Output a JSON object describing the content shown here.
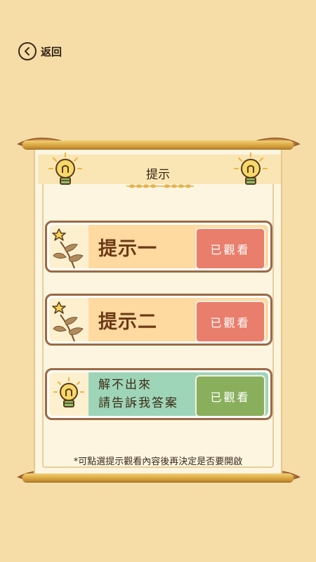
{
  "nav": {
    "back_label": "返回"
  },
  "panel": {
    "title": "提示"
  },
  "hints": [
    {
      "label": "提示一",
      "button": "已觀看"
    },
    {
      "label": "提示二",
      "button": "已觀看"
    },
    {
      "label_line1": "解不出來",
      "label_line2": "請告訴我答案",
      "button": "已觀看"
    }
  ],
  "footer_note": "*可點選提示觀看內容後再決定是否要開啟",
  "colors": {
    "background": "#f6dca6",
    "hint_body": "#fed9a0",
    "answer_body": "#9ed5b9",
    "watched_red": "#e97e6c",
    "watched_green": "#8aaf5c",
    "card_border": "#9a6a44"
  },
  "icons": [
    "back-arrow-icon",
    "lightbulb-icon",
    "star-leaf-icon",
    "wheat-divider-icon"
  ]
}
